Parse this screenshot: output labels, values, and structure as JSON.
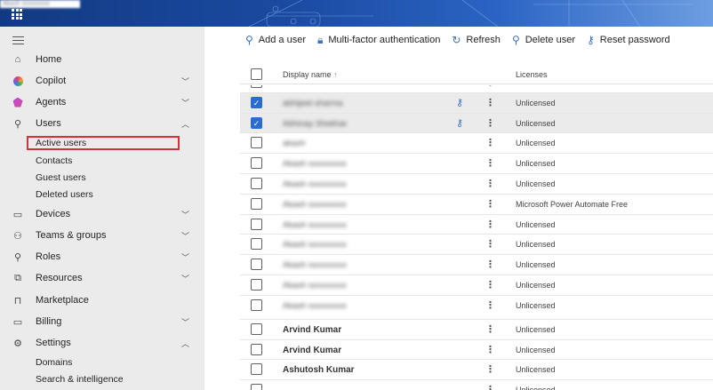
{
  "header": {
    "tenant": "Akash sxxxxxxxx",
    "waffle_icon": "app-launcher-icon"
  },
  "sidebar": {
    "items": [
      {
        "label": "Home",
        "icon": "home-icon"
      },
      {
        "label": "Copilot",
        "icon": "copilot-icon",
        "expand": "collapsed"
      },
      {
        "label": "Agents",
        "icon": "agents-icon",
        "expand": "collapsed"
      },
      {
        "label": "Users",
        "icon": "user-icon",
        "expand": "expanded"
      },
      {
        "label": "Devices",
        "icon": "devices-icon",
        "expand": "collapsed"
      },
      {
        "label": "Teams & groups",
        "icon": "teams-icon",
        "expand": "collapsed"
      },
      {
        "label": "Roles",
        "icon": "roles-icon",
        "expand": "collapsed"
      },
      {
        "label": "Resources",
        "icon": "resources-icon",
        "expand": "collapsed"
      },
      {
        "label": "Marketplace",
        "icon": "marketplace-icon"
      },
      {
        "label": "Billing",
        "icon": "billing-icon",
        "expand": "collapsed"
      },
      {
        "label": "Settings",
        "icon": "gear-icon",
        "expand": "expanded"
      }
    ],
    "users_sub": [
      "Active users",
      "Contacts",
      "Guest users",
      "Deleted users"
    ],
    "settings_sub": [
      "Domains",
      "Search & intelligence"
    ]
  },
  "toolbar": {
    "add_user": "Add a user",
    "mfa": "Multi-factor authentication",
    "refresh": "Refresh",
    "delete_user": "Delete user",
    "reset_password": "Reset password"
  },
  "table": {
    "col_name": "Display name",
    "sort_indicator": "↑",
    "col_licenses": "Licenses",
    "rows": [
      {
        "name": "abc",
        "license": "",
        "checked": false,
        "blur": false,
        "key": false
      },
      {
        "name": "abhijeet sharma",
        "license": "Unlicensed",
        "checked": true,
        "blur": true,
        "key": true
      },
      {
        "name": "Abhinay Shekhar",
        "license": "Unlicensed",
        "checked": true,
        "blur": true,
        "key": true
      },
      {
        "name": "akash",
        "license": "Unlicensed",
        "checked": false,
        "blur": true,
        "key": false
      },
      {
        "name": "Akash sxxxxxxxx",
        "license": "Unlicensed",
        "checked": false,
        "blur": true,
        "key": false
      },
      {
        "name": "Akash sxxxxxxxx",
        "license": "Unlicensed",
        "checked": false,
        "blur": true,
        "key": false
      },
      {
        "name": "Akash sxxxxxxxx",
        "license": "Microsoft Power Automate Free",
        "checked": false,
        "blur": true,
        "key": false
      },
      {
        "name": "Akash sxxxxxxxx",
        "license": "Unlicensed",
        "checked": false,
        "blur": true,
        "key": false
      },
      {
        "name": "Akash sxxxxxxxx",
        "license": "Unlicensed",
        "checked": false,
        "blur": true,
        "key": false
      },
      {
        "name": "Akash sxxxxxxxx",
        "license": "Unlicensed",
        "checked": false,
        "blur": true,
        "key": false
      },
      {
        "name": "Akash sxxxxxxxx",
        "license": "Unlicensed",
        "checked": false,
        "blur": true,
        "key": false
      },
      {
        "name": "Akash sxxxxxxxx",
        "license": "Unlicensed",
        "checked": false,
        "blur": true,
        "key": false,
        "tall": true
      },
      {
        "name": "Arvind Kumar",
        "license": "Unlicensed",
        "checked": false,
        "blur": false,
        "key": false
      },
      {
        "name": "Arvind Kumar",
        "license": "Unlicensed",
        "checked": false,
        "blur": false,
        "key": false
      },
      {
        "name": "Ashutosh Kumar",
        "license": "Unlicensed",
        "checked": false,
        "blur": false,
        "key": false
      },
      {
        "name": "",
        "license": "Unlicensed",
        "checked": false,
        "blur": true,
        "key": false
      }
    ]
  },
  "colors": {
    "accent": "#2b6cd1",
    "highlight_box": "#d13438",
    "sidebar_bg": "#ebebeb"
  }
}
